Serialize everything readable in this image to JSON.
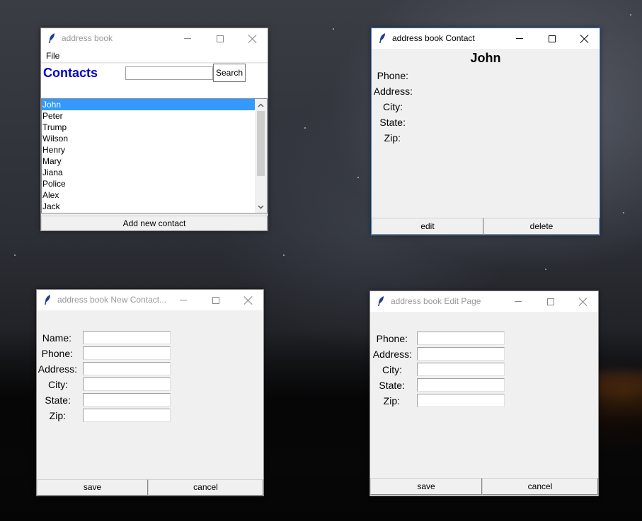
{
  "icons": {
    "window": "feather-icon",
    "minimize": "minimize-icon",
    "maximize": "maximize-icon",
    "close": "close-icon",
    "scroll_up": "chevron-up-icon",
    "scroll_down": "chevron-down-icon"
  },
  "colors": {
    "contacts_heading": "#0000cc",
    "list_selection": "#3399ff",
    "window_bg": "#f0f0f0"
  },
  "main_window": {
    "title": "address book",
    "menu_file": "File",
    "heading": "Contacts",
    "search_value": "",
    "search_button": "Search",
    "contacts": [
      "John",
      "Peter",
      "Trump",
      "Wilson",
      "Henry",
      "Mary",
      "Jiana",
      "Police",
      "Alex",
      "Jack"
    ],
    "selected_index": 0,
    "add_button": "Add new contact"
  },
  "contact_window": {
    "title": "address book Contact",
    "name": "John",
    "labels": {
      "phone": "Phone:",
      "address": "Address:",
      "city": "City:",
      "state": "State:",
      "zip": "Zip:"
    },
    "edit_button": "edit",
    "delete_button": "delete"
  },
  "new_contact_window": {
    "title": "address book New Contact...",
    "labels": {
      "name": "Name:",
      "phone": "Phone:",
      "address": "Address:",
      "city": "City:",
      "state": "State:",
      "zip": "Zip:"
    },
    "values": {
      "name": "",
      "phone": "",
      "address": "",
      "city": "",
      "state": "",
      "zip": ""
    },
    "save_button": "save",
    "cancel_button": "cancel"
  },
  "edit_window": {
    "title": "address book Edit Page",
    "labels": {
      "phone": "Phone:",
      "address": "Address:",
      "city": "City:",
      "state": "State:",
      "zip": "Zip:"
    },
    "values": {
      "phone": "",
      "address": "",
      "city": "",
      "state": "",
      "zip": ""
    },
    "save_button": "save",
    "cancel_button": "cancel"
  }
}
